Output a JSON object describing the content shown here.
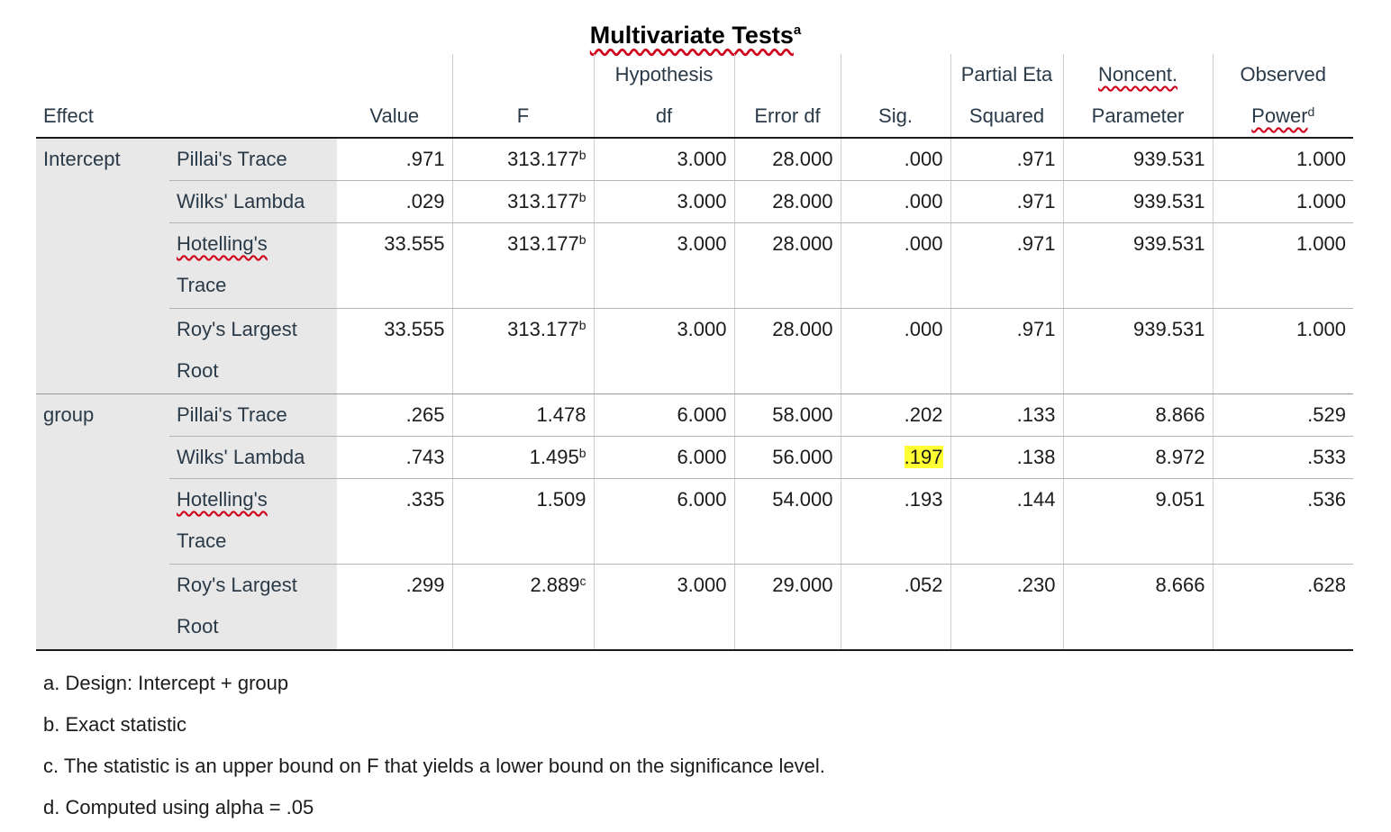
{
  "title": "Multivariate Tests",
  "title_sup": "a",
  "headers": {
    "effect": "Effect",
    "value": "Value",
    "f": "F",
    "hyp_top": "Hypothesis",
    "hyp_bottom": "df",
    "error_df": "Error df",
    "sig": "Sig.",
    "pe_top": "Partial Eta",
    "pe_bottom": "Squared",
    "nc_top": "Noncent.",
    "nc_bottom": "Parameter",
    "op_top": "Observed",
    "op_bottom": "Power",
    "op_sup": "d"
  },
  "rows": [
    {
      "effect": "Intercept",
      "stat": "Pillai's Trace",
      "value": ".971",
      "f": "313.177",
      "f_sup": "b",
      "hyp_df": "3.000",
      "error_df": "28.000",
      "sig": ".000",
      "pes": ".971",
      "noncent": "939.531",
      "power": "1.000"
    },
    {
      "effect": "",
      "stat": "Wilks' Lambda",
      "value": ".029",
      "f": "313.177",
      "f_sup": "b",
      "hyp_df": "3.000",
      "error_df": "28.000",
      "sig": ".000",
      "pes": ".971",
      "noncent": "939.531",
      "power": "1.000"
    },
    {
      "effect": "",
      "stat_a": "Hotelling's",
      "stat_b": "Trace",
      "value": "33.555",
      "f": "313.177",
      "f_sup": "b",
      "hyp_df": "3.000",
      "error_df": "28.000",
      "sig": ".000",
      "pes": ".971",
      "noncent": "939.531",
      "power": "1.000"
    },
    {
      "effect": "",
      "stat_a": "Roy's Largest",
      "stat_b": "Root",
      "value": "33.555",
      "f": "313.177",
      "f_sup": "b",
      "hyp_df": "3.000",
      "error_df": "28.000",
      "sig": ".000",
      "pes": ".971",
      "noncent": "939.531",
      "power": "1.000"
    },
    {
      "effect": "group",
      "stat": "Pillai's Trace",
      "value": ".265",
      "f": "1.478",
      "f_sup": "",
      "hyp_df": "6.000",
      "error_df": "58.000",
      "sig": ".202",
      "pes": ".133",
      "noncent": "8.866",
      "power": ".529"
    },
    {
      "effect": "",
      "stat": "Wilks' Lambda",
      "value": ".743",
      "f": "1.495",
      "f_sup": "b",
      "hyp_df": "6.000",
      "error_df": "56.000",
      "sig": ".197",
      "pes": ".138",
      "noncent": "8.972",
      "power": ".533"
    },
    {
      "effect": "",
      "stat_a": "Hotelling's",
      "stat_b": "Trace",
      "value": ".335",
      "f": "1.509",
      "f_sup": "",
      "hyp_df": "6.000",
      "error_df": "54.000",
      "sig": ".193",
      "pes": ".144",
      "noncent": "9.051",
      "power": ".536"
    },
    {
      "effect": "",
      "stat_a": "Roy's Largest",
      "stat_b": "Root",
      "value": ".299",
      "f": "2.889",
      "f_sup": "c",
      "hyp_df": "3.000",
      "error_df": "29.000",
      "sig": ".052",
      "pes": ".230",
      "noncent": "8.666",
      "power": ".628"
    }
  ],
  "highlight_color": "#ffff33",
  "spellcheck_color": "#d0021b",
  "footnotes": [
    "a. Design: Intercept + group",
    "b. Exact statistic",
    "c. The statistic is an upper bound on F that yields a lower bound on the significance level.",
    "d. Computed using alpha = .05"
  ]
}
